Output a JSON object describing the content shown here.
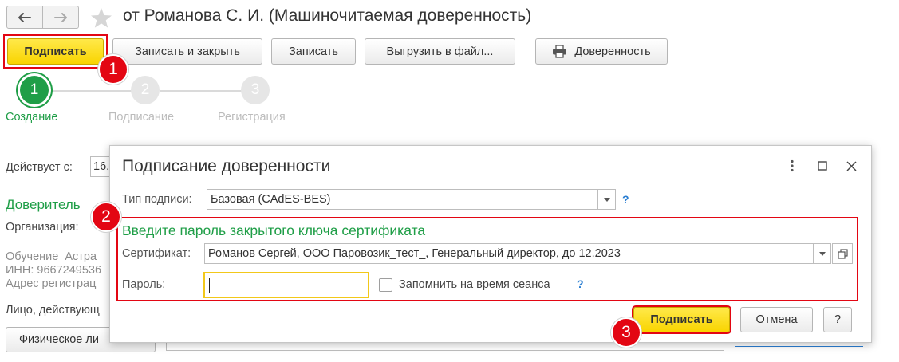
{
  "window": {
    "title": "от Романова С. И. (Машиночитаемая доверенность)"
  },
  "toolbar": {
    "sign_label": "Подписать",
    "save_close_label": "Записать и закрыть",
    "save_label": "Записать",
    "export_label": "Выгрузить в файл...",
    "print_label": "Доверенность"
  },
  "steps": [
    {
      "number": "1",
      "label": "Создание"
    },
    {
      "number": "2",
      "label": "Подписание"
    },
    {
      "number": "3",
      "label": "Регистрация"
    }
  ],
  "form": {
    "valid_from_label": "Действует с:",
    "valid_from_value": "16.",
    "principal_header": "Доверитель",
    "organization_label": "Организация:",
    "org_name": "Обучение_Астра",
    "inn": "ИНН: 9667249536",
    "address": "Адрес регистрац",
    "person_label": "Лицо, действующ",
    "person_type_button": "Физическое ли"
  },
  "dialog": {
    "title": "Подписание доверенности",
    "sign_type_label": "Тип подписи:",
    "sign_type_value": "Базовая (CAdES-BES)",
    "help_mark": "?",
    "password_prompt": "Введите пароль закрытого ключа сертификата",
    "certificate_label": "Сертификат:",
    "certificate_value": "Романов Сергей, ООО Паровозик_тест_, Генеральный директор, до 12.2023",
    "password_label": "Пароль:",
    "password_value": "",
    "remember_label": "Запомнить на время сеанса",
    "sign_button": "Подписать",
    "cancel_button": "Отмена",
    "help_button": "?"
  },
  "callouts": [
    "1",
    "2",
    "3"
  ],
  "colors": {
    "accent_green": "#1f9e47",
    "highlight_red": "#e30613",
    "button_yellow": "#f9d400",
    "help_blue": "#2a7ed2"
  }
}
